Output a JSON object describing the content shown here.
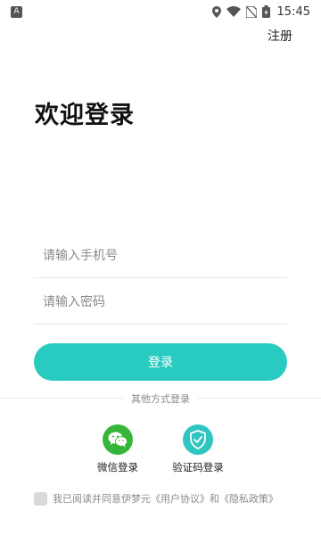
{
  "status_bar": {
    "time": "15:45",
    "app_icon_letter": "A",
    "icons": [
      "location-icon",
      "wifi-icon",
      "sim-off-icon",
      "battery-icon"
    ]
  },
  "header": {
    "register_label": "注册"
  },
  "title": "欢迎登录",
  "form": {
    "phone_placeholder": "请输入手机号",
    "phone_value": "",
    "password_placeholder": "请输入密码",
    "password_value": "",
    "login_label": "登录"
  },
  "other_login": {
    "divider_label": "其他方式登录",
    "options": [
      {
        "label": "微信登录",
        "icon": "wechat-icon",
        "color": "#35b53a"
      },
      {
        "label": "验证码登录",
        "icon": "shield-check-icon",
        "color": "#2fc6c1"
      }
    ]
  },
  "agreement": {
    "checked": false,
    "prefix": "我已阅读并同意伊梦元",
    "user_agreement": "《用户协议》",
    "conjunction": "和",
    "privacy_policy": "《隐私政策》"
  },
  "colors": {
    "accent": "#29cbc1",
    "wechat": "#35b53a",
    "muted_text": "#8a8a8a"
  }
}
